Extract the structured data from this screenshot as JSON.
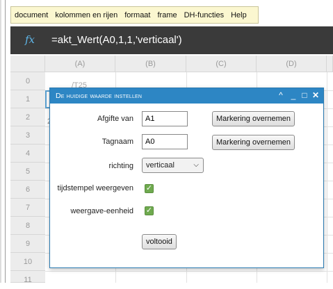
{
  "menubar": {
    "items": [
      "document",
      "kolommen en rijen",
      "formaat",
      "frame",
      "DH-functies",
      "Help"
    ]
  },
  "formula_bar": {
    "fx_label": "fx",
    "formula": "=akt_Wert(A0,1,1,'verticaal')"
  },
  "sheet": {
    "columns": [
      "(A)",
      "(B)",
      "(C)",
      "(D)"
    ],
    "rows": [
      "0",
      "1",
      "2",
      "3",
      "4",
      "5",
      "6",
      "7",
      "8",
      "9",
      "10",
      "11"
    ],
    "cell_a0": "/T25",
    "cell_a2": "2"
  },
  "dialog": {
    "title": "De huidige waarde instellen",
    "controls": {
      "collapse": "^",
      "minimize": "_",
      "maximize": "□",
      "close": "✕"
    },
    "fields": {
      "afgifte_label": "Afgifte van",
      "afgifte_value": "A1",
      "tagnaam_label": "Tagnaam",
      "tagnaam_value": "A0",
      "richting_label": "richting",
      "richting_value": "verticaal",
      "tijdstempel_label": "tijdstempel weergeven",
      "tijdstempel_checked": true,
      "eenheid_label": "weergave-eenheid",
      "eenheid_checked": true
    },
    "buttons": {
      "markering1": "Markering overnemen",
      "markering2": "Markering overnemen",
      "done": "voltooid"
    }
  },
  "colors": {
    "dialog_title_bg": "#2d86c4",
    "formula_bar_bg": "#3a3a3a",
    "fx_color": "#5fb6e8",
    "menubar_bg": "#fbf7d0",
    "checkbox_green": "#6faa4f"
  }
}
